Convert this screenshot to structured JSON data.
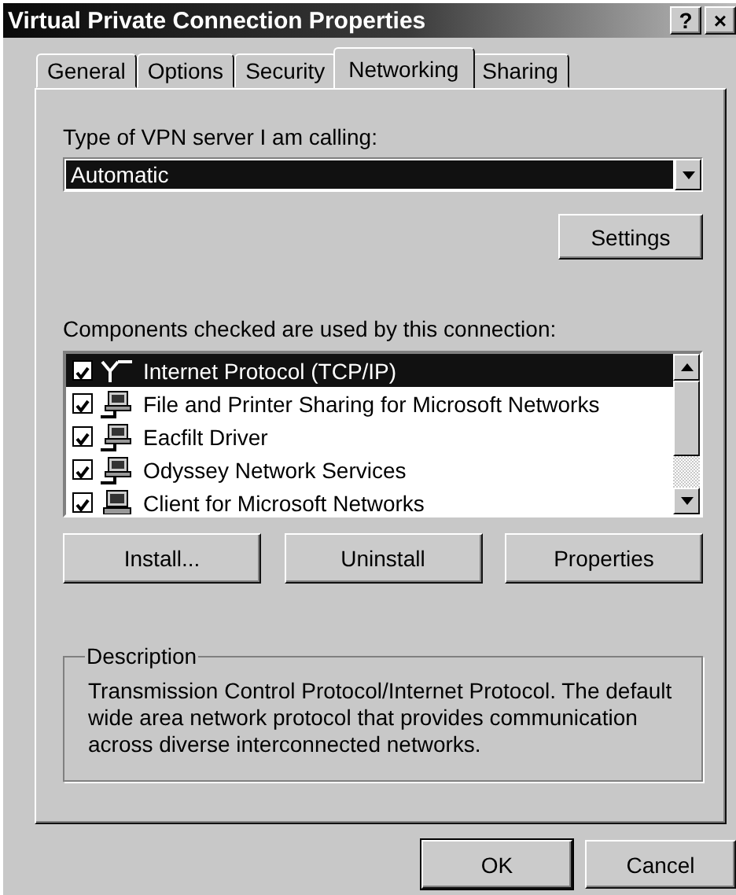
{
  "window": {
    "title": "Virtual Private Connection Properties",
    "title_buttons": [
      "?",
      "×"
    ]
  },
  "tabs": [
    {
      "label": "General",
      "selected": false
    },
    {
      "label": "Options",
      "selected": false
    },
    {
      "label": "Security",
      "selected": false
    },
    {
      "label": "Networking",
      "selected": true
    },
    {
      "label": "Sharing",
      "selected": false
    }
  ],
  "vpn_type": {
    "label": "Type of VPN server I am calling:",
    "value": "Automatic",
    "settings_button": "Settings"
  },
  "components": {
    "label": "Components checked are used by this connection:",
    "items": [
      {
        "name": "Internet Protocol (TCP/IP)",
        "kind": "protocol",
        "checked": true,
        "selected": true
      },
      {
        "name": "File and Printer Sharing for Microsoft Networks",
        "kind": "service",
        "checked": true,
        "selected": false
      },
      {
        "name": "Eacfilt Driver",
        "kind": "service",
        "checked": true,
        "selected": false
      },
      {
        "name": "Odyssey Network Services",
        "kind": "service",
        "checked": true,
        "selected": false
      },
      {
        "name": "Client for Microsoft Networks",
        "kind": "client",
        "checked": true,
        "selected": false
      }
    ],
    "buttons": [
      "Install...",
      "Uninstall",
      "Properties"
    ]
  },
  "description": {
    "title": "Description",
    "text": "Transmission Control Protocol/Internet Protocol. The default wide area network protocol that provides communication across diverse interconnected networks."
  },
  "buttons": [
    "OK",
    "Cancel"
  ]
}
